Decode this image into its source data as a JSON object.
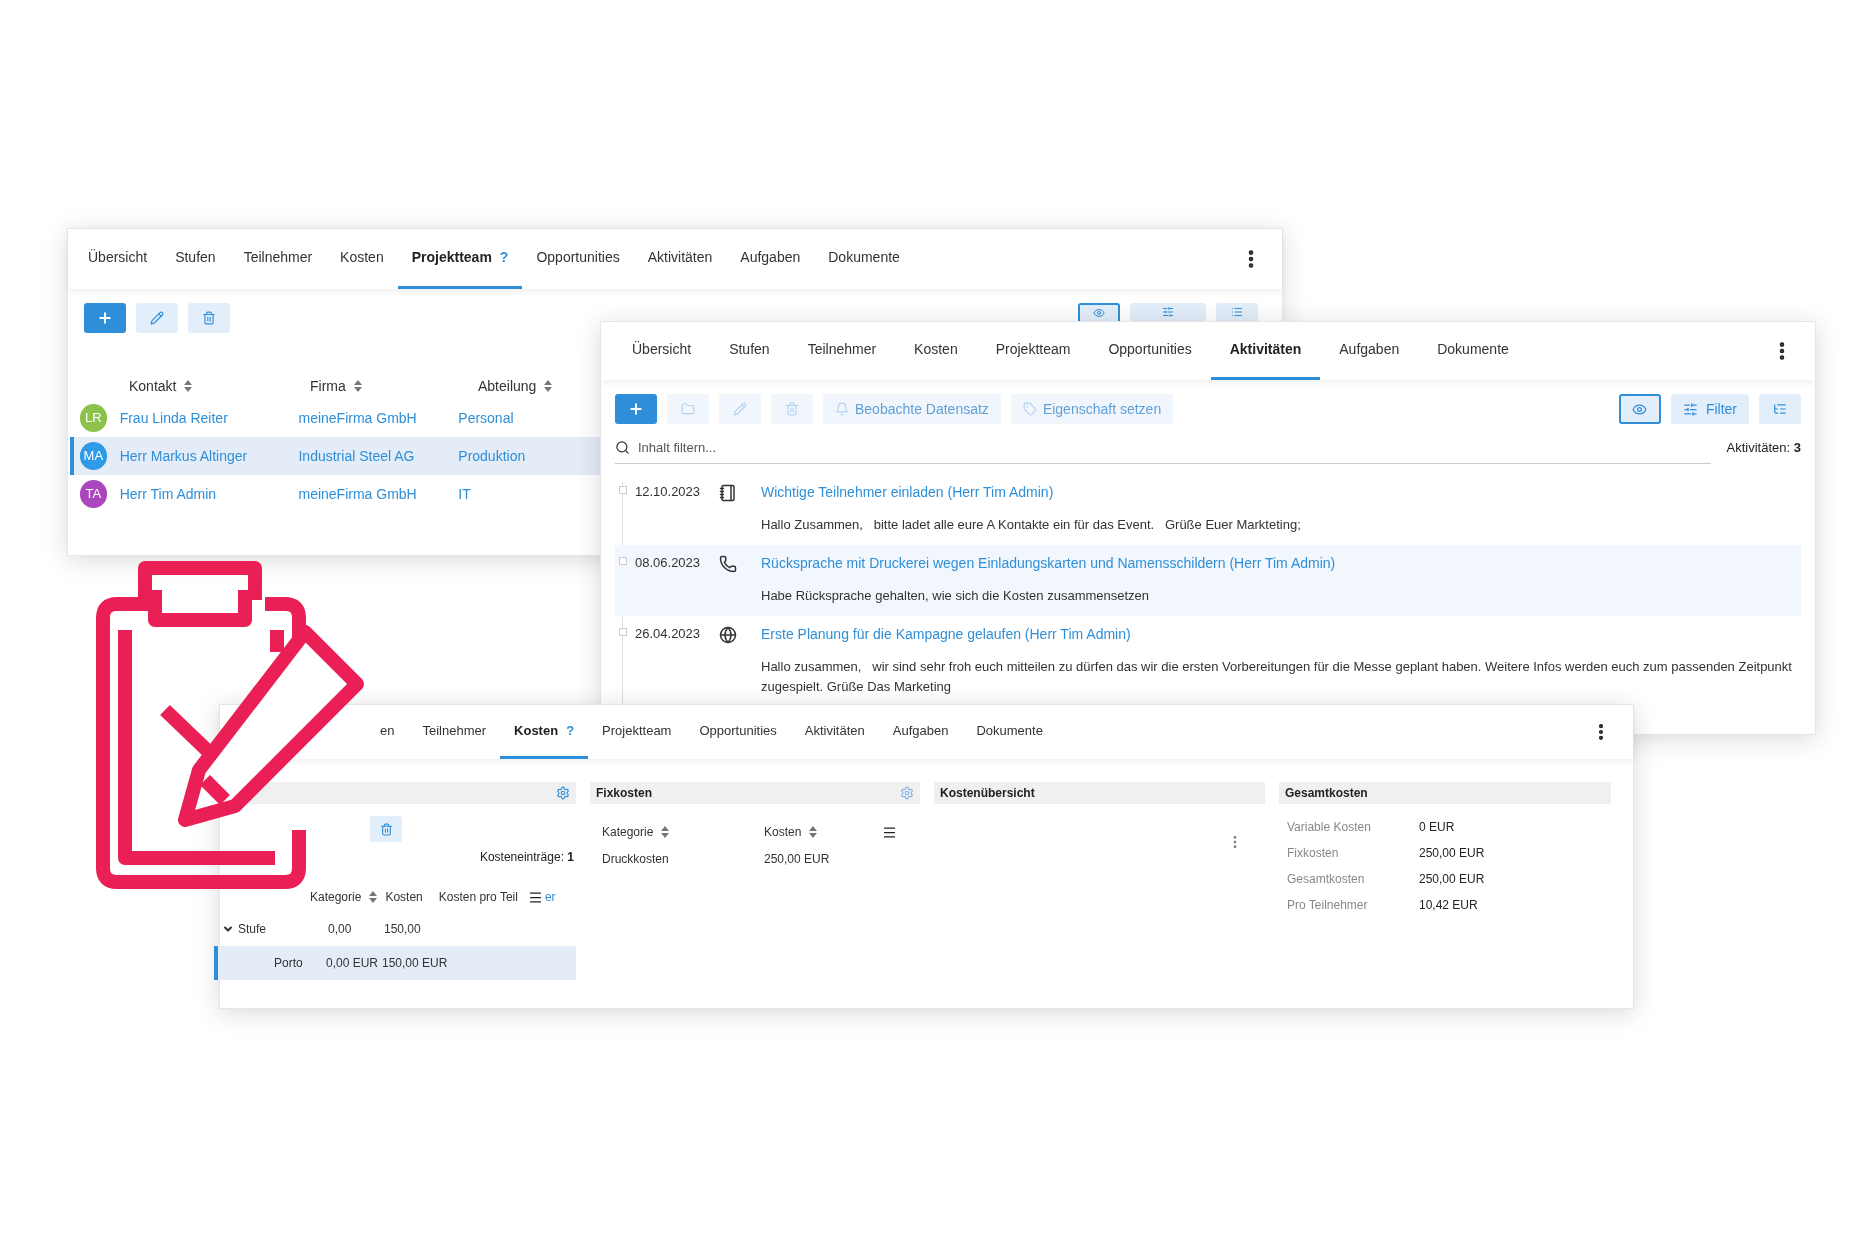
{
  "project_team_window": {
    "tabs": [
      {
        "label": "Übersicht",
        "selected": false
      },
      {
        "label": "Stufen",
        "selected": false
      },
      {
        "label": "Teilnehmer",
        "selected": false
      },
      {
        "label": "Kosten",
        "selected": false
      },
      {
        "label": "Projektteam",
        "selected": true,
        "help": "?"
      },
      {
        "label": "Opportunities",
        "selected": false
      },
      {
        "label": "Aktivitäten",
        "selected": false
      },
      {
        "label": "Aufgaben",
        "selected": false
      },
      {
        "label": "Dokumente",
        "selected": false
      }
    ],
    "table": {
      "columns": [
        "Kontakt",
        "Firma",
        "Abteilung"
      ],
      "rows": [
        {
          "initials": "LR",
          "color": "#8bc34a",
          "contact": "Frau Linda Reiter",
          "company": "meineFirma GmbH",
          "department": "Personal",
          "selected": false
        },
        {
          "initials": "MA",
          "color": "#2f9be8",
          "contact": "Herr Markus Altinger",
          "company": "Industrial Steel AG",
          "department": "Produktion",
          "selected": true
        },
        {
          "initials": "TA",
          "color": "#ab47bc",
          "contact": "Herr Tim Admin",
          "company": "meineFirma GmbH",
          "department": "IT",
          "selected": false
        }
      ]
    }
  },
  "activities_window": {
    "tabs": [
      {
        "label": "Übersicht",
        "selected": false
      },
      {
        "label": "Stufen",
        "selected": false
      },
      {
        "label": "Teilnehmer",
        "selected": false
      },
      {
        "label": "Kosten",
        "selected": false
      },
      {
        "label": "Projektteam",
        "selected": false
      },
      {
        "label": "Opportunities",
        "selected": false
      },
      {
        "label": "Aktivitäten",
        "selected": true
      },
      {
        "label": "Aufgaben",
        "selected": false
      },
      {
        "label": "Dokumente",
        "selected": false
      }
    ],
    "toolbar": [
      {
        "kind": "add",
        "disabled": false
      },
      {
        "kind": "folder",
        "disabled": true
      },
      {
        "kind": "edit",
        "disabled": true
      },
      {
        "kind": "delete",
        "disabled": true
      },
      {
        "kind": "watch",
        "label": "Beobachte Datensatz",
        "disabled": true
      },
      {
        "kind": "tag",
        "label": "Eigenschaft setzen",
        "disabled": true
      }
    ],
    "view_toggle": {
      "selected": true
    },
    "filter": "Filter",
    "search": {
      "placeholder": "Inhalt filtern..."
    },
    "count_label": "Aktivitäten:",
    "count": "3",
    "activities": [
      {
        "date": "12.10.2023",
        "kind": "note",
        "title": "Wichtige Teilnehmer einladen (Herr Tim Admin)",
        "text": "Hallo Zusammen,   bitte ladet alle eure A Kontakte ein für das Event.   Grüße Euer Markteting;",
        "selected": false
      },
      {
        "date": "08.06.2023",
        "kind": "call",
        "title": "Rücksprache mit Druckerei wegen Einladungskarten und Namensschildern (Herr Tim Admin)",
        "text": "Habe Rücksprache gehalten, wie sich die Kosten zusammensetzen",
        "selected": true
      },
      {
        "date": "26.04.2023",
        "kind": "web",
        "title": "Erste Planung für die Kampagne gelaufen (Herr Tim Admin)",
        "text": "Hallo zusammen,   wir sind sehr froh euch mitteilen zu dürfen das wir die ersten Vorbereitungen für die Messe geplant haben. Weitere Infos werden euch zum passenden Zeitpunkt zugespielt. Grüße Das Marketing",
        "selected": false
      }
    ]
  },
  "costs_window": {
    "tabs": [
      {
        "label": "en",
        "selected": false
      },
      {
        "label": "Teilnehmer",
        "selected": false
      },
      {
        "label": "Kosten",
        "selected": true,
        "help": "?"
      },
      {
        "label": "Projektteam",
        "selected": false
      },
      {
        "label": "Opportunities",
        "selected": false
      },
      {
        "label": "Aktivitäten",
        "selected": false
      },
      {
        "label": "Aufgaben",
        "selected": false
      },
      {
        "label": "Dokumente",
        "selected": false
      }
    ],
    "variable_panel": {
      "entries_label": "Kosteneinträge:",
      "entries_count": "1",
      "columns": [
        "Kategorie",
        "Kosten",
        "Kosten pro Teil",
        "er"
      ],
      "groups": [
        {
          "label": "Stufe",
          "expanded": true,
          "cost": "0,00",
          "per_part": "150,00",
          "children": [
            {
              "label": "Porto",
              "cost": "0,00 EUR",
              "per_part": "150,00 EUR",
              "selected": true
            }
          ]
        }
      ]
    },
    "fixed_panel": {
      "title": "Fixkosten",
      "columns": [
        "Kategorie",
        "Kosten"
      ],
      "rows": [
        {
          "category": "Druckkosten",
          "cost": "250,00 EUR"
        }
      ]
    },
    "overview_panel": {
      "title": "Kostenübersicht"
    },
    "total_panel": {
      "title": "Gesamtkosten",
      "rows": [
        {
          "label": "Variable Kosten",
          "value": "0 EUR"
        },
        {
          "label": "Fixkosten",
          "value": "250,00 EUR"
        },
        {
          "label": "Gesamtkosten",
          "value": "250,00 EUR"
        },
        {
          "label": "Pro Teilnehmer",
          "value": "10,42 EUR"
        }
      ]
    }
  }
}
